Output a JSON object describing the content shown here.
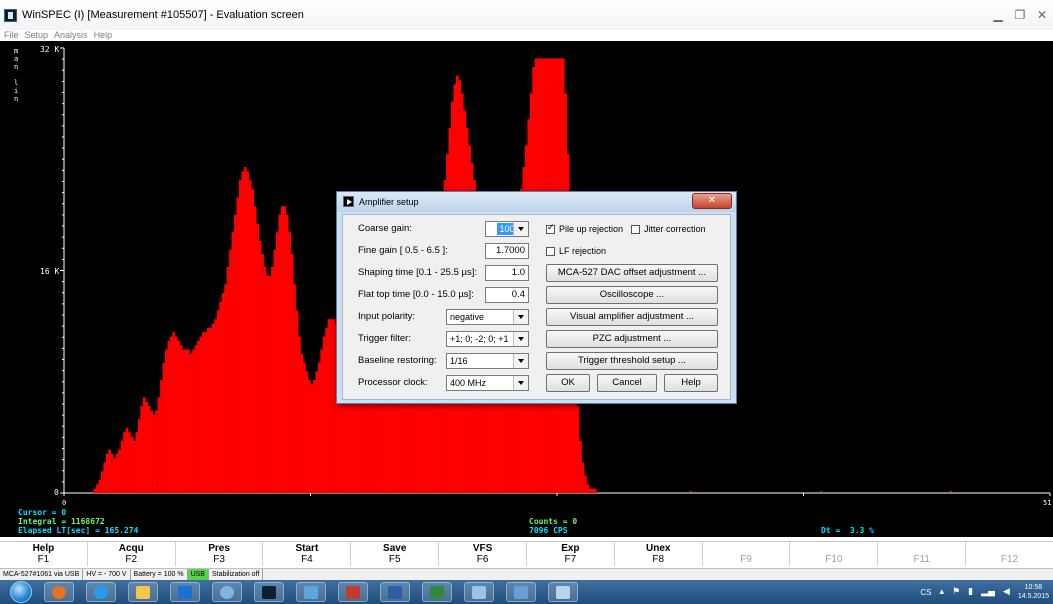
{
  "window": {
    "title": "WinSPEC (I) [Measurement #105507] - Evaluation screen",
    "controls": [
      "minimize",
      "maximize",
      "close"
    ]
  },
  "menu": [
    "File",
    "Setup",
    "Analysis",
    "Help"
  ],
  "plot": {
    "mode_letters": [
      "m",
      "a",
      "n",
      "",
      "l",
      "i",
      "n"
    ],
    "y_ticks": [
      "32 K",
      "16 K",
      "0"
    ],
    "x_ticks": [
      "0",
      "51"
    ]
  },
  "chart_data": {
    "type": "bar",
    "y_max": 32000,
    "ylim": [
      0,
      32768
    ],
    "x_range_channels": [
      0,
      400
    ],
    "values": [
      0,
      0,
      0,
      0,
      0,
      0,
      0,
      0,
      0,
      0,
      0,
      0,
      1,
      2,
      3,
      5,
      7,
      9,
      10,
      9,
      8,
      9,
      10,
      12,
      14,
      15,
      14,
      13,
      12,
      14,
      17,
      20,
      22,
      21,
      20,
      19,
      18,
      19,
      22,
      26,
      30,
      33,
      35,
      36,
      37,
      36,
      35,
      34,
      33,
      33,
      33,
      32,
      33,
      34,
      35,
      36,
      37,
      37,
      38,
      38,
      39,
      40,
      42,
      44,
      46,
      48,
      52,
      56,
      60,
      64,
      68,
      72,
      74,
      75,
      74,
      72,
      70,
      66,
      62,
      58,
      55,
      52,
      50,
      50,
      52,
      56,
      60,
      64,
      66,
      66,
      64,
      60,
      55,
      48,
      42,
      36,
      32,
      30,
      28,
      26,
      25,
      26,
      28,
      30,
      33,
      36,
      38,
      40,
      40,
      40,
      39,
      38,
      37,
      38,
      40,
      42,
      44,
      46,
      48,
      50,
      51,
      50,
      48,
      46,
      44,
      42,
      40,
      39,
      38,
      38,
      37,
      36,
      35,
      33,
      30,
      28,
      26,
      24,
      23,
      22,
      23,
      25,
      28,
      31,
      34,
      37,
      40,
      42,
      45,
      48,
      52,
      56,
      61,
      66,
      72,
      78,
      84,
      90,
      94,
      96,
      95,
      92,
      88,
      84,
      80,
      76,
      72,
      68,
      64,
      60,
      56,
      52,
      48,
      46,
      44,
      43,
      42,
      42,
      43,
      45,
      48,
      52,
      56,
      60,
      65,
      70,
      75,
      80,
      86,
      92,
      98,
      100,
      100,
      100,
      100,
      100,
      100,
      100,
      100,
      100,
      100,
      100,
      100,
      92,
      78,
      62,
      46,
      32,
      20,
      12,
      7,
      4,
      2,
      1,
      1,
      1,
      0,
      0,
      0,
      0,
      0,
      0,
      0,
      0,
      0,
      0,
      0,
      0,
      0,
      0,
      0,
      0,
      0,
      0,
      0,
      0,
      0,
      0,
      0,
      0,
      0,
      0,
      0,
      0,
      0,
      0,
      0,
      0,
      0,
      0,
      0,
      0,
      0
    ]
  },
  "info": {
    "cursor": "Cursor = 0",
    "integral": "Integral = 1168672",
    "elapsed": "Elapsed LT[sec] = 165.274",
    "counts": "Counts = 0",
    "cps": "7096 CPS",
    "dt": "Dt =  3.3 %"
  },
  "fkeys": [
    {
      "name": "Help",
      "key": "F1"
    },
    {
      "name": "Acqu",
      "key": "F2"
    },
    {
      "name": "Pres",
      "key": "F3"
    },
    {
      "name": "Start",
      "key": "F4"
    },
    {
      "name": "Save",
      "key": "F5"
    },
    {
      "name": "VFS",
      "key": "F6"
    },
    {
      "name": "Exp",
      "key": "F7"
    },
    {
      "name": "Unex",
      "key": "F8"
    },
    {
      "name": "",
      "key": "F9"
    },
    {
      "name": "",
      "key": "F10"
    },
    {
      "name": "",
      "key": "F11"
    },
    {
      "name": "",
      "key": "F12"
    }
  ],
  "status": {
    "device": "MCA-527#1061 via USB",
    "hv": "HV = - 700 V",
    "battery": "Battery = 100 %",
    "usb": "USB",
    "stabilization": "Stabilization off"
  },
  "dialog": {
    "title": "Amplifier setup",
    "close_label": "✕",
    "coarse_gain_label": "Coarse gain:",
    "coarse_gain_value": "100",
    "fine_gain_label": "Fine gain [ 0.5 - 6.5 ]:",
    "fine_gain_value": "1.7000",
    "shaping_label": "Shaping time [0.1 - 25.5 µs]:",
    "shaping_value": "1.0",
    "flat_top_label": "Flat top time [0.0 - 15.0 µs]:",
    "flat_top_value": "0.4",
    "polarity_label": "Input polarity:",
    "polarity_value": "negative",
    "trigger_filter_label": "Trigger filter:",
    "trigger_filter_value": "+1; 0; -2; 0; +1",
    "baseline_label": "Baseline restoring:",
    "baseline_value": "1/16",
    "clock_label": "Processor clock:",
    "clock_value": "400 MHz",
    "pileup_label": "Pile up rejection",
    "pileup_checked": true,
    "jitter_label": "Jitter correction",
    "jitter_checked": false,
    "lf_label": "LF rejection",
    "lf_checked": false,
    "dac_button": "MCA-527 DAC offset adjustment ...",
    "osc_button": "Oscilloscope ...",
    "visual_button": "Visual amplifier adjustment ...",
    "pzc_button": "PZC adjustment ...",
    "trigger_button": "Trigger threshold setup ...",
    "ok_button": "OK",
    "cancel_button": "Cancel",
    "help_button": "Help"
  },
  "taskbar": {
    "lang": "CS",
    "time": "10:58",
    "date": "14.5.2015"
  },
  "colors": {
    "spectrum": "#ff0000",
    "plot_bg": "#000000",
    "info_cyan": "#00e5ff",
    "info_green": "#6ff56f"
  }
}
